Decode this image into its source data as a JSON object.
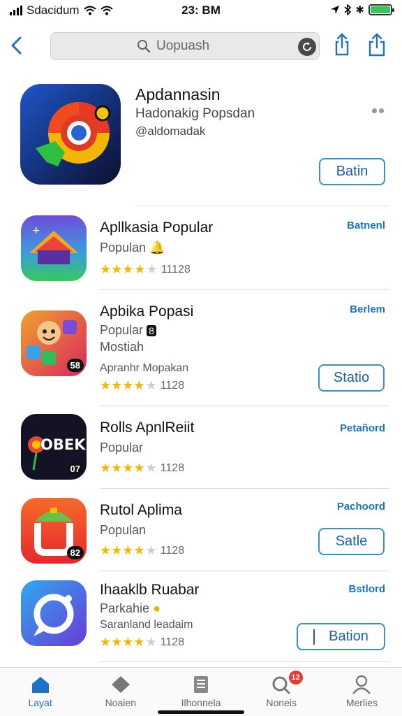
{
  "status_bar": {
    "carrier": "Sdacidum",
    "time": "23: BM"
  },
  "nav": {
    "search_placeholder": "Uopuash"
  },
  "featured": {
    "title": "Apdannasin",
    "subtitle": "Hadonakig Popsdan",
    "developer": "@aldomadak",
    "button_label": "Batin"
  },
  "apps": [
    {
      "name": "Apllkasia Popular",
      "line1": "Populan",
      "rating": 3.5,
      "rating_count": "11128",
      "tag": "Batnenl"
    },
    {
      "name": "Apbika Popasi",
      "line1": "Popular",
      "line2": "Mostiah",
      "line3": "Apranhr Mopakan",
      "rating": 4,
      "rating_count": "1128",
      "tag": "Berlem",
      "button_label": "Statio",
      "icon_badge": "58"
    },
    {
      "name": "Rolls ApnlReiit",
      "line1": "Popular",
      "rating": 4.5,
      "rating_count": "1128",
      "tag": "Petañord",
      "icon_badge": "07",
      "icon_text": "OBEK"
    },
    {
      "name": "Rutol Aplima",
      "line1": "Populan",
      "rating": 4,
      "rating_count": "1128",
      "tag": "Pachoord",
      "button_label": "Satle",
      "icon_badge": "82"
    },
    {
      "name": "Ihaaklb Ruabar",
      "line1": "Parkahie",
      "line2": "Saranland leadaim",
      "rating": 4.5,
      "rating_count": "1128",
      "tag": "Bstlord",
      "button_label": "Bation"
    }
  ],
  "tabs": [
    {
      "label": "Layat",
      "icon": "home-icon",
      "active": true
    },
    {
      "label": "Noaien",
      "icon": "diamond-icon"
    },
    {
      "label": "Ilhonnelа",
      "icon": "document-icon"
    },
    {
      "label": "Noneis",
      "icon": "search-notifications-icon",
      "badge": "12"
    },
    {
      "label": "Merlies",
      "icon": "profile-icon"
    }
  ],
  "colors": {
    "accent": "#1a73c9",
    "star": "#f5b800",
    "badge": "#e53935"
  }
}
